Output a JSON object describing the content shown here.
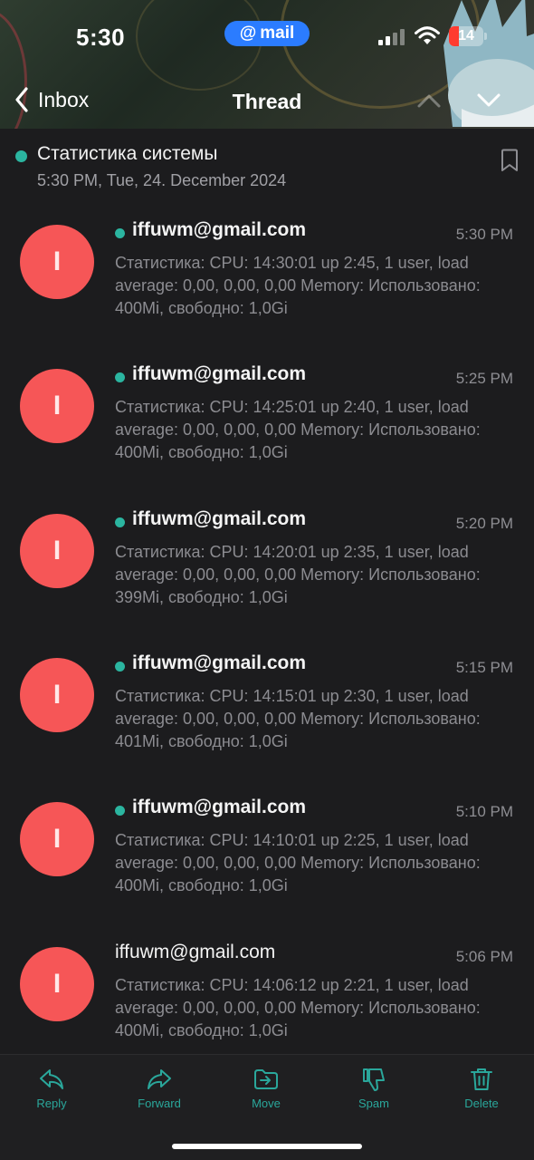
{
  "status_bar": {
    "time": "5:30",
    "mail_pill": "mail",
    "battery_level": "14",
    "battery_color": "#ff3b30"
  },
  "nav": {
    "back_label": "Inbox",
    "title": "Thread"
  },
  "thread": {
    "subject": "Статистика системы",
    "date": "5:30 PM, Tue, 24. December 2024"
  },
  "messages": [
    {
      "avatar_letter": "I",
      "sender": "iffuwm@gmail.com",
      "time": "5:30 PM",
      "unread": true,
      "preview": "Статистика: CPU: 14:30:01 up 2:45, 1 user, load average: 0,00, 0,00, 0,00 Memory: Использовано: 400Mi, свободно: 1,0Gi"
    },
    {
      "avatar_letter": "I",
      "sender": "iffuwm@gmail.com",
      "time": "5:25 PM",
      "unread": true,
      "preview": "Статистика: CPU: 14:25:01 up 2:40, 1 user, load average: 0,00, 0,00, 0,00 Memory: Использовано: 400Mi, свободно: 1,0Gi"
    },
    {
      "avatar_letter": "I",
      "sender": "iffuwm@gmail.com",
      "time": "5:20 PM",
      "unread": true,
      "preview": "Статистика: CPU: 14:20:01 up 2:35, 1 user, load average: 0,00, 0,00, 0,00 Memory: Использовано: 399Mi, свободно: 1,0Gi"
    },
    {
      "avatar_letter": "I",
      "sender": "iffuwm@gmail.com",
      "time": "5:15 PM",
      "unread": true,
      "preview": "Статистика: CPU: 14:15:01 up 2:30, 1 user, load average: 0,00, 0,00, 0,00 Memory: Использовано: 401Mi, свободно: 1,0Gi"
    },
    {
      "avatar_letter": "I",
      "sender": "iffuwm@gmail.com",
      "time": "5:10 PM",
      "unread": true,
      "preview": "Статистика: CPU: 14:10:01 up 2:25, 1 user, load average: 0,00, 0,00, 0,00 Memory: Использовано: 400Mi, свободно: 1,0Gi"
    },
    {
      "avatar_letter": "I",
      "sender": "iffuwm@gmail.com",
      "time": "5:06 PM",
      "unread": false,
      "preview": "Статистика: CPU: 14:06:12 up 2:21, 1 user, load average: 0,00, 0,00, 0,00 Memory: Использовано: 400Mi, свободно: 1,0Gi"
    }
  ],
  "toolbar": {
    "reply_label": "Reply",
    "forward_label": "Forward",
    "move_label": "Move",
    "spam_label": "Spam",
    "delete_label": "Delete",
    "accent_color": "#2aa79b"
  },
  "colors": {
    "avatar": "#f65657",
    "unread_dot": "#2bb5a0",
    "background": "#1c1c1e"
  }
}
